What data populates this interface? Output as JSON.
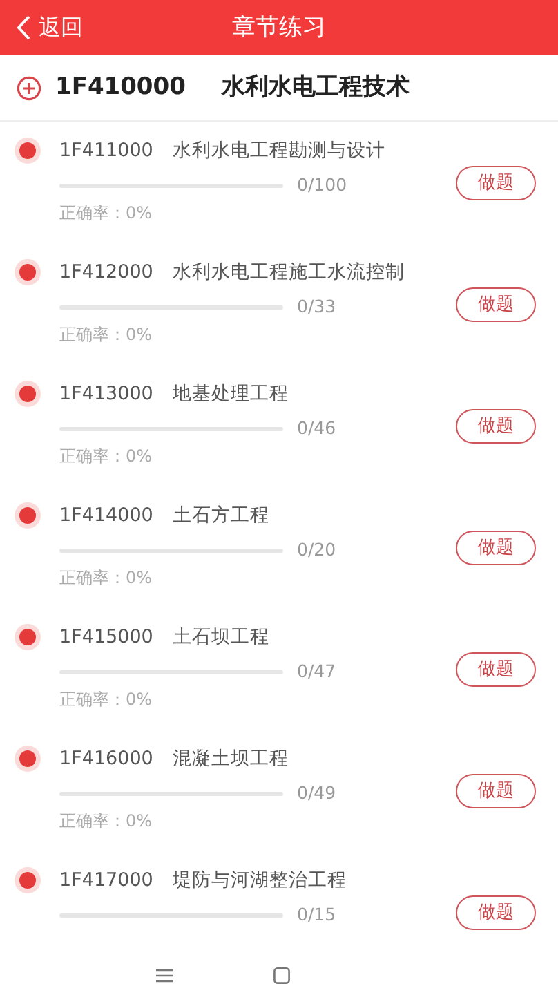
{
  "header": {
    "back": "返回",
    "title": "章节练习"
  },
  "chapter": {
    "code": "1F410000",
    "name": "水利水电工程技术"
  },
  "sections": [
    {
      "code": "1F411000",
      "name": "水利水电工程勘测与设计",
      "level": 0,
      "count": "0/100",
      "accuracy": "正确率：0%",
      "button": "做题"
    },
    {
      "code": "1F412000",
      "name": "水利水电工程施工水流控制",
      "level": 0,
      "count": "0/33",
      "accuracy": "正确率：0%",
      "button": "做题"
    },
    {
      "code": "1F413000",
      "name": "地基处理工程",
      "level": 0,
      "count": "0/46",
      "accuracy": "正确率：0%",
      "button": "做题"
    },
    {
      "code": "1F414000",
      "name": "土石方工程",
      "level": 0,
      "count": "0/20",
      "accuracy": "正确率：0%",
      "button": "做题"
    },
    {
      "code": "1F415000",
      "name": "土石坝工程",
      "level": 0,
      "count": "0/47",
      "accuracy": "正确率：0%",
      "button": "做题"
    },
    {
      "code": "1F416000",
      "name": "混凝土坝工程",
      "level": 0,
      "count": "0/49",
      "accuracy": "正确率：0%",
      "button": "做题"
    },
    {
      "code": "1F417000",
      "name": "堤防与河湖整治工程",
      "level": 0,
      "count": "0/15",
      "button": "做题"
    }
  ]
}
